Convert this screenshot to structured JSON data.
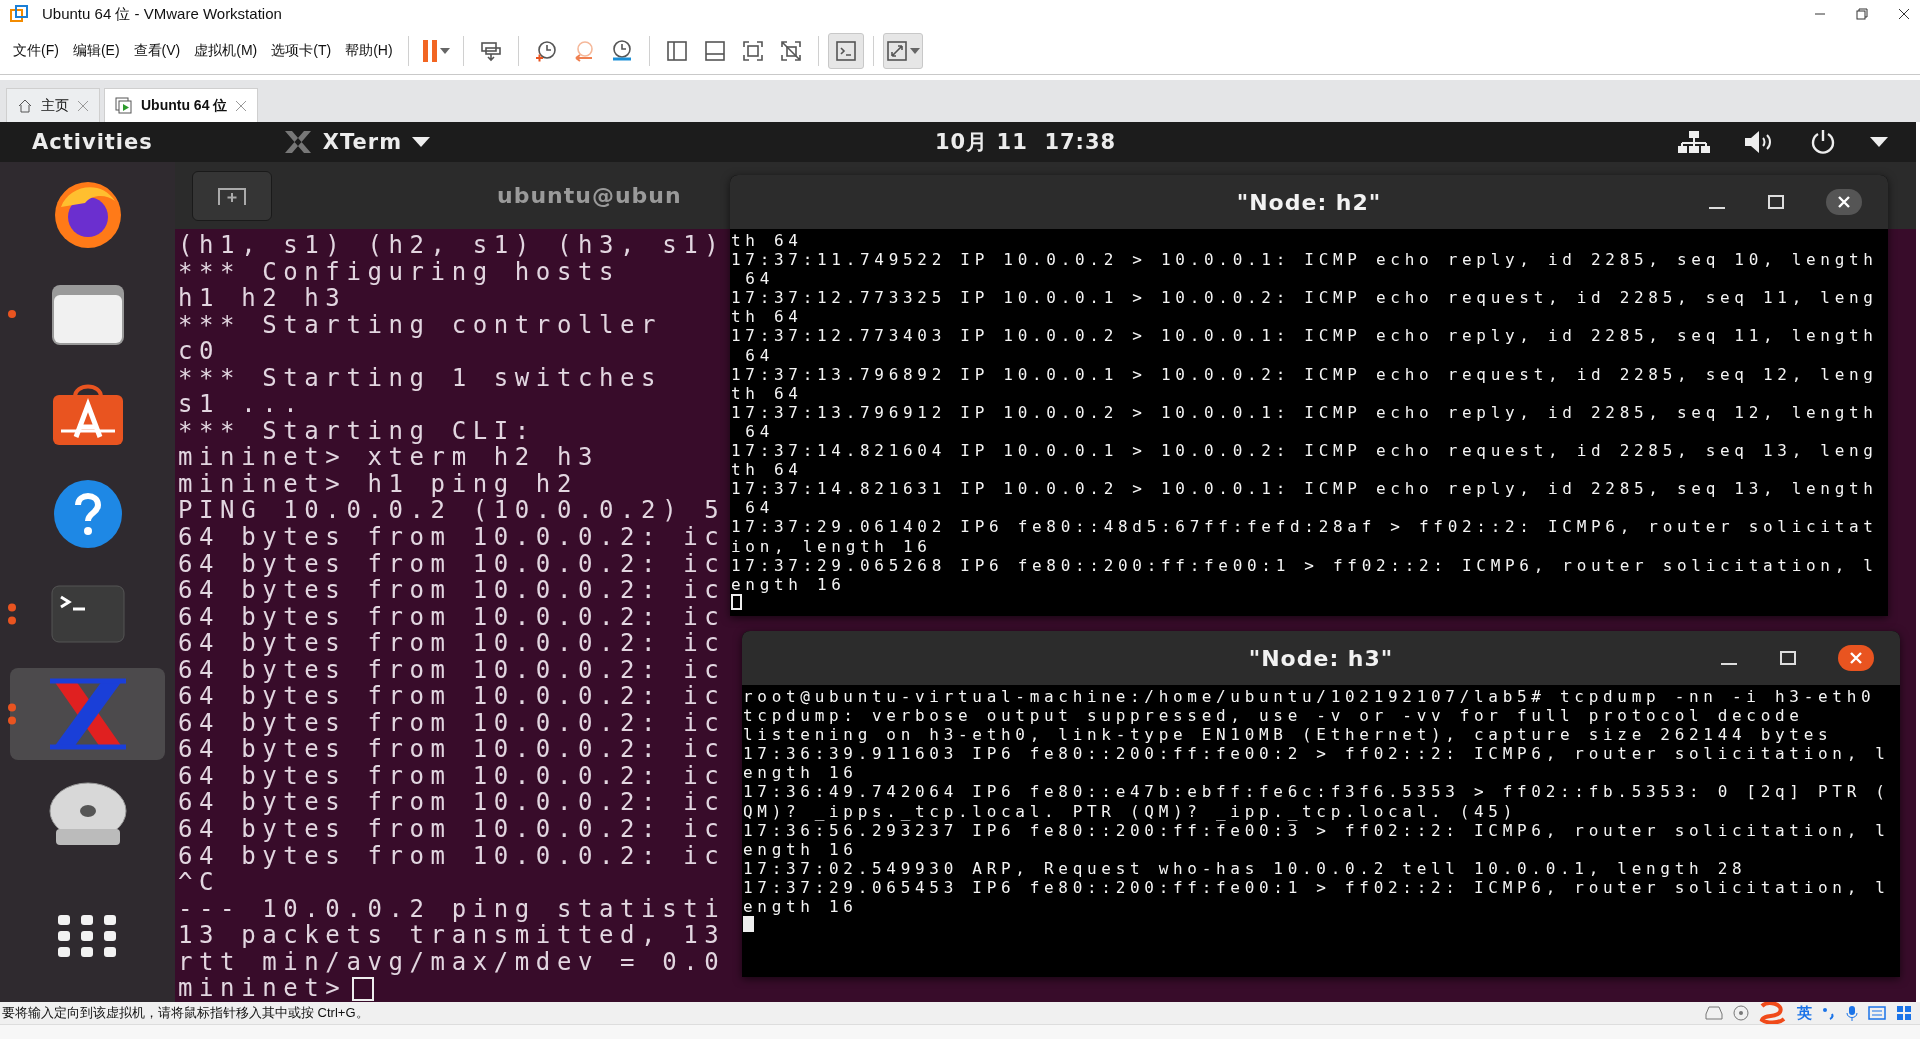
{
  "window": {
    "title": "Ubuntu 64 位 - VMware Workstation"
  },
  "menu": [
    "文件(F)",
    "编辑(E)",
    "查看(V)",
    "虚拟机(M)",
    "选项卡(T)",
    "帮助(H)"
  ],
  "toolbar": [
    [
      {
        "kind": "pause",
        "pressed": false
      }
    ],
    [
      {
        "kind": "send-keys",
        "pressed": false
      }
    ],
    [
      {
        "kind": "snapshot-take",
        "pressed": false
      },
      {
        "kind": "snapshot-revert",
        "pressed": false
      },
      {
        "kind": "snapshot-manager",
        "pressed": false
      }
    ],
    [
      {
        "kind": "view-sidebar",
        "pressed": false
      },
      {
        "kind": "view-thumbnail",
        "pressed": false
      },
      {
        "kind": "fit",
        "pressed": false
      },
      {
        "kind": "no-fit",
        "pressed": false
      }
    ],
    [
      {
        "kind": "console",
        "pressed": true
      }
    ],
    [
      {
        "kind": "fullscreen",
        "pressed": true
      }
    ]
  ],
  "tabs": [
    {
      "kind": "home",
      "label": "主页",
      "selected": false
    },
    {
      "kind": "vm",
      "label": "Ubuntu 64 位",
      "selected": true
    }
  ],
  "guest": {
    "top_bar": {
      "activities": "Activities",
      "app_name": "XTerm",
      "clock": "10月 11  17:38"
    },
    "dock": [
      {
        "kind": "browser",
        "running": false,
        "multiple_windows": false,
        "selected": false
      },
      {
        "kind": "files",
        "running": true,
        "multiple_windows": false,
        "selected": false
      },
      {
        "kind": "software",
        "running": false,
        "multiple_windows": false,
        "selected": false
      },
      {
        "kind": "help",
        "running": false,
        "multiple_windows": false,
        "selected": false
      },
      {
        "kind": "terminal",
        "running": true,
        "multiple_windows": true,
        "selected": false
      },
      {
        "kind": "xterm",
        "running": true,
        "multiple_windows": true,
        "selected": true
      },
      {
        "kind": "disc",
        "running": false,
        "multiple_windows": false,
        "selected": false
      },
      {
        "kind": "apps",
        "running": false,
        "multiple_windows": false,
        "selected": false
      }
    ],
    "windows": [
      {
        "kind": "main",
        "title": "ubuntu@ubun",
        "focused": false,
        "lines": [
          "(h1, s1) (h2, s1) (h3, s1)",
          "*** Configuring hosts",
          "h1 h2 h3",
          "*** Starting controller",
          "c0",
          "*** Starting 1 switches",
          "s1 ...",
          "*** Starting CLI:",
          "mininet> xterm h2 h3",
          "mininet> h1 ping h2",
          "PING 10.0.0.2 (10.0.0.2) 5",
          "64 bytes from 10.0.0.2: ic",
          "64 bytes from 10.0.0.2: ic",
          "64 bytes from 10.0.0.2: ic",
          "64 bytes from 10.0.0.2: ic",
          "64 bytes from 10.0.0.2: ic",
          "64 bytes from 10.0.0.2: ic",
          "64 bytes from 10.0.0.2: ic",
          "64 bytes from 10.0.0.2: ic",
          "64 bytes from 10.0.0.2: ic",
          "64 bytes from 10.0.0.2: ic",
          "64 bytes from 10.0.0.2: ic",
          "64 bytes from 10.0.0.2: ic",
          "64 bytes from 10.0.0.2: ic",
          "^C",
          "--- 10.0.0.2 ping statisti",
          "13 packets transmitted, 13",
          "rtt min/avg/max/mdev = 0.0",
          "mininet>"
        ]
      },
      {
        "kind": "node",
        "title": "\"Node: h2\"",
        "focused": false,
        "lines": [
          "th 64",
          "17:37:11.749522 IP 10.0.0.2 > 10.0.0.1: ICMP echo reply, id 2285, seq 10, length",
          " 64",
          "17:37:12.773325 IP 10.0.0.1 > 10.0.0.2: ICMP echo request, id 2285, seq 11, leng",
          "th 64",
          "17:37:12.773403 IP 10.0.0.2 > 10.0.0.1: ICMP echo reply, id 2285, seq 11, length",
          " 64",
          "17:37:13.796892 IP 10.0.0.1 > 10.0.0.2: ICMP echo request, id 2285, seq 12, leng",
          "th 64",
          "17:37:13.796912 IP 10.0.0.2 > 10.0.0.1: ICMP echo reply, id 2285, seq 12, length",
          " 64",
          "17:37:14.821604 IP 10.0.0.1 > 10.0.0.2: ICMP echo request, id 2285, seq 13, leng",
          "th 64",
          "17:37:14.821631 IP 10.0.0.2 > 10.0.0.1: ICMP echo reply, id 2285, seq 13, length",
          " 64",
          "17:37:29.061402 IP6 fe80::48d5:67ff:fefd:28af > ff02::2: ICMP6, router solicitat",
          "ion, length 16",
          "17:37:29.065268 IP6 fe80::200:ff:fe00:1 > ff02::2: ICMP6, router solicitation, l",
          "ength 16"
        ]
      },
      {
        "kind": "node",
        "title": "\"Node: h3\"",
        "focused": true,
        "lines": [
          "root@ubuntu-virtual-machine:/home/ubuntu/102192107/lab5# tcpdump -nn -i h3-eth0",
          "tcpdump: verbose output suppressed, use -v or -vv for full protocol decode",
          "listening on h3-eth0, link-type EN10MB (Ethernet), capture size 262144 bytes",
          "17:36:39.911603 IP6 fe80::200:ff:fe00:2 > ff02::2: ICMP6, router solicitation, l",
          "ength 16",
          "17:36:49.742064 IP6 fe80::e47b:ebff:fe6c:f3f6.5353 > ff02::fb.5353: 0 [2q] PTR (",
          "QM)? _ipps._tcp.local. PTR (QM)? _ipp._tcp.local. (45)",
          "17:36:56.293237 IP6 fe80::200:ff:fe00:3 > ff02::2: ICMP6, router solicitation, l",
          "ength 16",
          "17:37:02.549930 ARP, Request who-has 10.0.0.2 tell 10.0.0.1, length 28",
          "17:37:29.065453 IP6 fe80::200:ff:fe00:1 > ff02::2: ICMP6, router solicitation, l",
          "ength 16"
        ]
      }
    ]
  },
  "status_bar": {
    "message": "要将输入定向到该虚拟机，请将鼠标指针移入其中或按 Ctrl+G。",
    "ime_mode": "英"
  }
}
